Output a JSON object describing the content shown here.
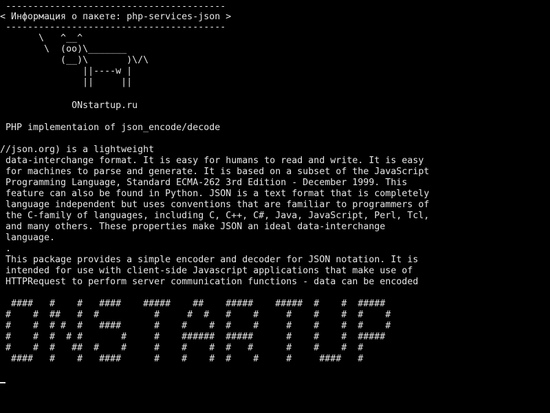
{
  "terminal": {
    "speech_bubble": {
      "top_border": " ----------------------------------------",
      "text": "< Информация о пакете: php-services-json >",
      "bottom_border": " ----------------------------------------"
    },
    "cow": [
      "       \\   ^__^",
      "        \\  (oo)\\_______",
      "           (__)\\       )\\/\\",
      "               ||----w |",
      "               ||     ||"
    ],
    "site": "             ONstartup.ru",
    "summary": " PHP implementaion of json_encode/decode",
    "description": [
      "//json.org) is a lightweight",
      " data-interchange format. It is easy for humans to read and write. It is easy",
      " for machines to parse and generate. It is based on a subset of the JavaScript",
      " Programming Language, Standard ECMA-262 3rd Edition - December 1999. This",
      " feature can also be found in Python. JSON is a text format that is completely",
      " language independent but uses conventions that are familiar to programmers of",
      " the C-family of languages, including C, C++, C#, Java, JavaScript, Perl, Tcl,",
      " and many others. These properties make JSON an ideal data-interchange",
      " language.",
      " .",
      " This package provides a simple encoder and decoder for JSON notation. It is",
      " intended for use with client-side Javascript applications that make use of",
      " HTTPRequest to perform server communication functions - data can be encoded"
    ],
    "banner": [
      "  ####   #    #   ####    #####    ##    #####    #####  #    #  #####",
      " #    #  ##   #  #          #     #  #   #    #     #    #    #  #    #",
      " #    #  # #  #   ####      #    #    #  #    #     #    #    #  #    #",
      " #    #  #  # #       #     #    ######  #####      #    #    #  #####",
      " #    #  #   ##  #    #     #    #    #  #   #      #    #    #  #",
      "  ####   #    #   ####      #    #    #  #    #     #     ####   #"
    ]
  }
}
